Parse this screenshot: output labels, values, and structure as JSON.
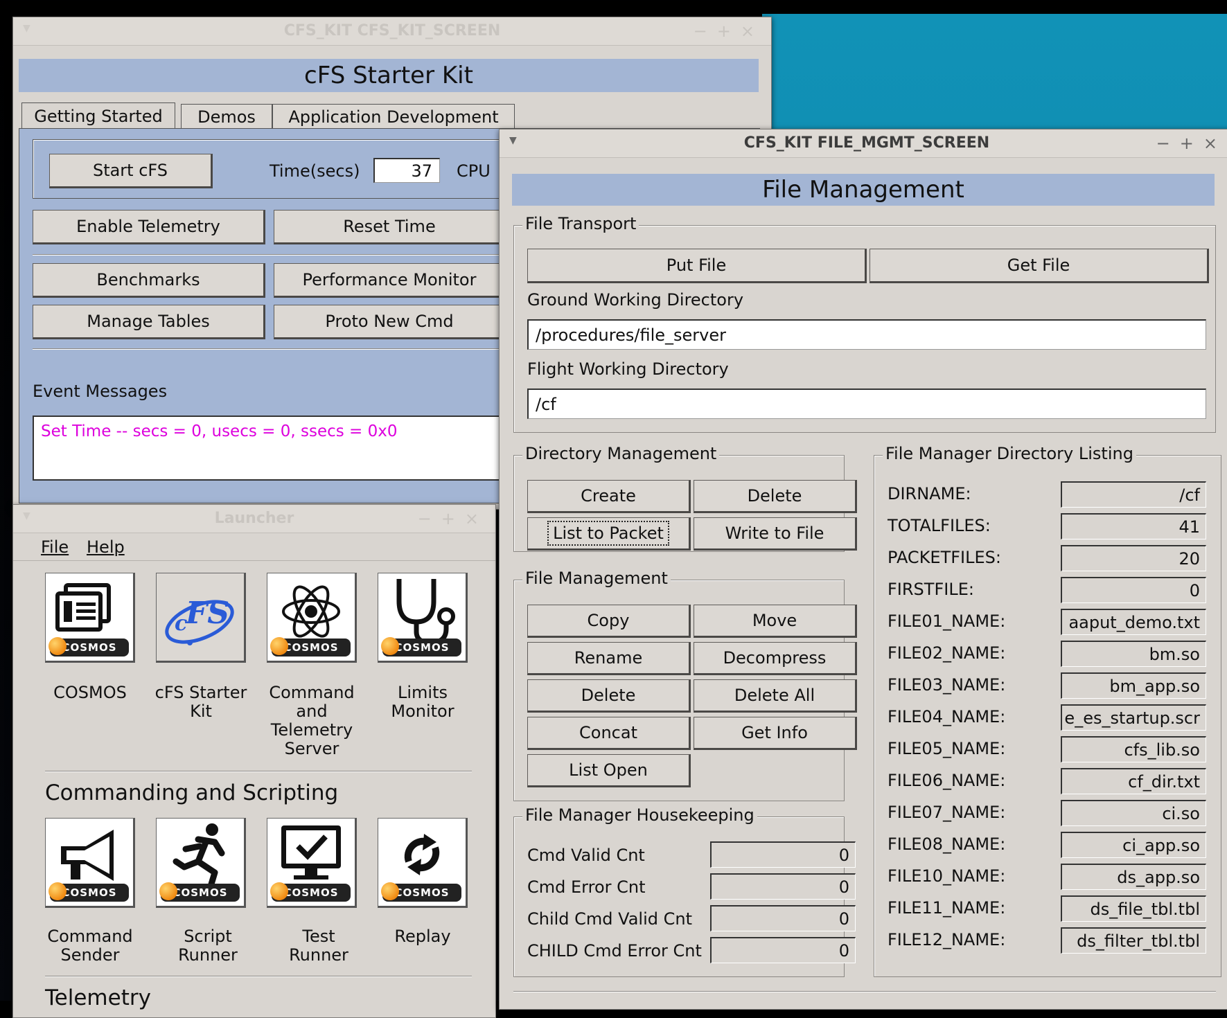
{
  "colors": {
    "banner": "#a3b5d4",
    "event_text": "#dd00dd",
    "desktop_teal": "#1192b7"
  },
  "kit_window": {
    "title": "CFS_KIT CFS_KIT_SCREEN",
    "banner": "cFS Starter Kit",
    "tabs": [
      "Getting Started",
      "Demos",
      "Application Development"
    ],
    "start_button": "Start cFS",
    "time_label": "Time(secs)",
    "time_value": "37",
    "cpu_label": "CPU",
    "buttons": {
      "enable_telemetry": "Enable Telemetry",
      "reset_time": "Reset Time",
      "benchmarks": "Benchmarks",
      "performance_monitor": "Performance Monitor",
      "manage_tables": "Manage Tables",
      "proto_new_cmd": "Proto New Cmd"
    },
    "event_label": "Event Messages",
    "event_text": "Set Time -- secs = 0, usecs = 0, ssecs = 0x0"
  },
  "launcher": {
    "title": "Launcher",
    "menu": {
      "file": "File",
      "help": "Help"
    },
    "apps_top": [
      {
        "label": "COSMOS",
        "icon": "cosmos-icon"
      },
      {
        "label": "cFS Starter Kit",
        "icon": "cfs-logo-icon"
      },
      {
        "label": "Command and Telemetry Server",
        "icon": "atom-icon"
      },
      {
        "label": "Limits Monitor",
        "icon": "stethoscope-icon"
      }
    ],
    "section_cmd": "Commanding and Scripting",
    "apps_cmd": [
      {
        "label": "Command Sender",
        "icon": "megaphone-icon"
      },
      {
        "label": "Script Runner",
        "icon": "runner-icon"
      },
      {
        "label": "Test Runner",
        "icon": "monitor-check-icon"
      },
      {
        "label": "Replay",
        "icon": "replay-icon"
      }
    ],
    "section_tlm": "Telemetry",
    "badge": "COSMOS"
  },
  "file_window": {
    "title": "CFS_KIT FILE_MGMT_SCREEN",
    "banner": "File Management",
    "transport": {
      "legend": "File Transport",
      "put": "Put File",
      "get": "Get File",
      "ground_label": "Ground Working Directory",
      "ground_value": "/procedures/file_server",
      "flight_label": "Flight Working Directory",
      "flight_value": "/cf"
    },
    "dirmgmt": {
      "legend": "Directory Management",
      "create": "Create",
      "delete": "Delete",
      "list_to_packet": "List to Packet",
      "write_to_file": "Write to File"
    },
    "filemgmt": {
      "legend": "File Management",
      "copy": "Copy",
      "move": "Move",
      "rename": "Rename",
      "decompress": "Decompress",
      "delete": "Delete",
      "delete_all": "Delete All",
      "concat": "Concat",
      "get_info": "Get Info",
      "list_open": "List Open"
    },
    "hk": {
      "legend": "File Manager Housekeeping",
      "rows": [
        {
          "label": "Cmd Valid Cnt",
          "value": "0"
        },
        {
          "label": "Cmd Error Cnt",
          "value": "0"
        },
        {
          "label": "Child Cmd Valid Cnt",
          "value": "0"
        },
        {
          "label": "CHILD Cmd Error Cnt",
          "value": "0"
        }
      ]
    },
    "listing": {
      "legend": "File Manager Directory Listing",
      "rows": [
        {
          "label": "DIRNAME:",
          "value": "/cf"
        },
        {
          "label": "TOTALFILES:",
          "value": "41"
        },
        {
          "label": "PACKETFILES:",
          "value": "20"
        },
        {
          "label": "FIRSTFILE:",
          "value": "0"
        },
        {
          "label": "FILE01_NAME:",
          "value": "aaput_demo.txt"
        },
        {
          "label": "FILE02_NAME:",
          "value": "bm.so"
        },
        {
          "label": "FILE03_NAME:",
          "value": "bm_app.so"
        },
        {
          "label": "FILE04_NAME:",
          "value": "e_es_startup.scr"
        },
        {
          "label": "FILE05_NAME:",
          "value": "cfs_lib.so"
        },
        {
          "label": "FILE06_NAME:",
          "value": "cf_dir.txt"
        },
        {
          "label": "FILE07_NAME:",
          "value": "ci.so"
        },
        {
          "label": "FILE08_NAME:",
          "value": "ci_app.so"
        },
        {
          "label": "FILE10_NAME:",
          "value": "ds_app.so"
        },
        {
          "label": "FILE11_NAME:",
          "value": "ds_file_tbl.tbl"
        },
        {
          "label": "FILE12_NAME:",
          "value": "ds_filter_tbl.tbl"
        }
      ]
    }
  }
}
